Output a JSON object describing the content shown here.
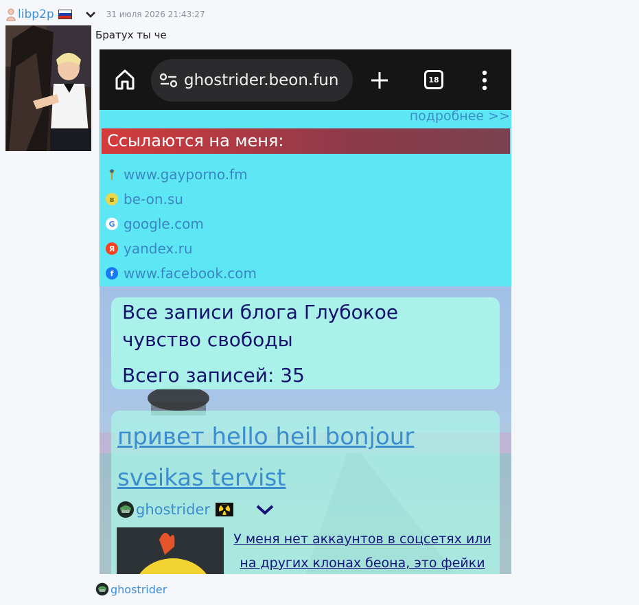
{
  "post": {
    "username": "libp2p",
    "timestamp": "31 июля 2026 21:43:27",
    "message": "Братух ты че",
    "flag_colors": [
      "#ffffff",
      "#1c3fae",
      "#d52b1e"
    ]
  },
  "browser": {
    "url": "ghostrider.beon.fun",
    "tab_count": "18"
  },
  "site": {
    "more_link": "подробнее >>",
    "refs_title": "Ссылаются на меня:",
    "refs": [
      {
        "text": "www.gayporno.fm",
        "icon": "torch-icon"
      },
      {
        "text": "be-on.su",
        "icon": "beon-icon",
        "glyph": "в"
      },
      {
        "text": "google.com",
        "icon": "google-icon",
        "glyph": "G"
      },
      {
        "text": "yandex.ru",
        "icon": "yandex-icon",
        "glyph": "Я"
      },
      {
        "text": "www.facebook.com",
        "icon": "facebook-icon",
        "glyph": "f"
      }
    ],
    "blog_title": "Все записи блога Глубокое чувство свободы",
    "blog_count": "Всего записей: 35",
    "post_title": "привет hello heil bonjour sveikas tervist",
    "author": "ghostrider",
    "post_desc": "У меня нет аккаунтов в соцсетях или на других клонах беона, это фейки"
  },
  "footer": {
    "username": "ghostrider"
  }
}
